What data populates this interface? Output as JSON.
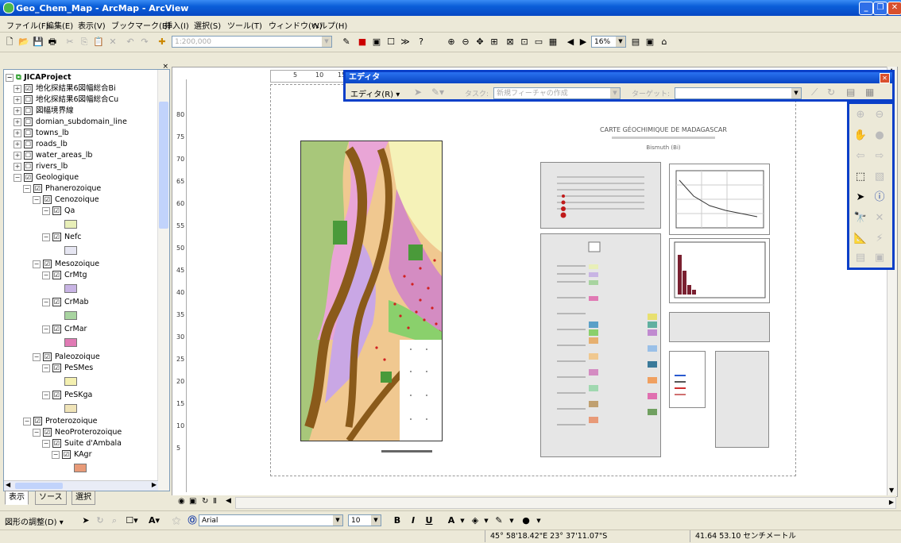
{
  "window": {
    "title": "Geo_Chem_Map - ArcMap - ArcView"
  },
  "menu": [
    "ファイル(F)",
    "編集(E)",
    "表示(V)",
    "ブックマーク(B)",
    "挿入(I)",
    "選択(S)",
    "ツール(T)",
    "ウィンドウ(W)",
    "ヘルプ(H)"
  ],
  "toolbar": {
    "scale": "1:200,000",
    "zoom": "16%"
  },
  "toc": {
    "project": "JICAProject",
    "layers": [
      {
        "label": "地化探結果6図幅総合Bi",
        "checked": "☑"
      },
      {
        "label": "地化探結果6図幅総合Cu",
        "checked": "☐"
      },
      {
        "label": "図幅境界線",
        "checked": "☐"
      },
      {
        "label": "domian_subdomain_line",
        "checked": "☐"
      },
      {
        "label": "towns_lb",
        "checked": "☐"
      },
      {
        "label": "roads_lb",
        "checked": "☐"
      },
      {
        "label": "water_areas_lb",
        "checked": "☐"
      },
      {
        "label": "rivers_lb",
        "checked": "☐"
      },
      {
        "label": "Geologique",
        "checked": "☑"
      },
      {
        "label": "Phanerozoique",
        "checked": "☑"
      },
      {
        "label": "Cenozoique",
        "checked": "☑"
      },
      {
        "label": "Qa",
        "checked": "☑"
      },
      {
        "label": "Nefc",
        "checked": "☑"
      },
      {
        "label": "Mesozoique",
        "checked": "☑"
      },
      {
        "label": "CrMtg",
        "checked": "☑"
      },
      {
        "label": "CrMab",
        "checked": "☑"
      },
      {
        "label": "CrMar",
        "checked": "☑"
      },
      {
        "label": "Paleozoique",
        "checked": "☑"
      },
      {
        "label": "PeSMes",
        "checked": "☑"
      },
      {
        "label": "PeSKga",
        "checked": "☑"
      },
      {
        "label": "Proterozoique",
        "checked": "☑"
      },
      {
        "label": "NeoProterozoique",
        "checked": "☑"
      },
      {
        "label": "Suite d'Ambala",
        "checked": "☑"
      },
      {
        "label": "KAgr",
        "checked": "☑"
      }
    ],
    "swatches": {
      "Qa": "#e8efb8",
      "Nefc": "#e6e6f2",
      "CrMtg": "#c8b4e4",
      "CrMab": "#a8d4a0",
      "CrMar": "#e07ab4",
      "PeSMes": "#f4f0b0",
      "PeSKga": "#f0e4b8",
      "KAgr": "#e89a78"
    },
    "tabs": [
      "表示",
      "ソース",
      "選択"
    ]
  },
  "editor": {
    "title": "エディタ",
    "menu": "エディタ(R)",
    "task_label": "タスク:",
    "task_value": "新規フィーチャの作成",
    "target_label": "ターゲット:"
  },
  "map_layout": {
    "title": "CARTE GÉOCHIMIQUE DE MADAGASCAR",
    "subtitle": "Bismuth (Bi)",
    "ruler_h": [
      "5",
      "10",
      "15"
    ],
    "ruler_v": [
      "80",
      "75",
      "70",
      "65",
      "60",
      "55",
      "50",
      "45",
      "40",
      "35",
      "30",
      "25",
      "20",
      "15",
      "10",
      "5"
    ]
  },
  "drawing": {
    "adjust": "図形の調整(D)",
    "font": "Arial",
    "size": "10",
    "bold": "B",
    "italic": "I",
    "underline": "U",
    "font_color": "A"
  },
  "status": {
    "coords": "45° 58'18.42\"E  23° 37'11.07\"S",
    "page_pos": "41.64  53.10 センチメートル"
  }
}
